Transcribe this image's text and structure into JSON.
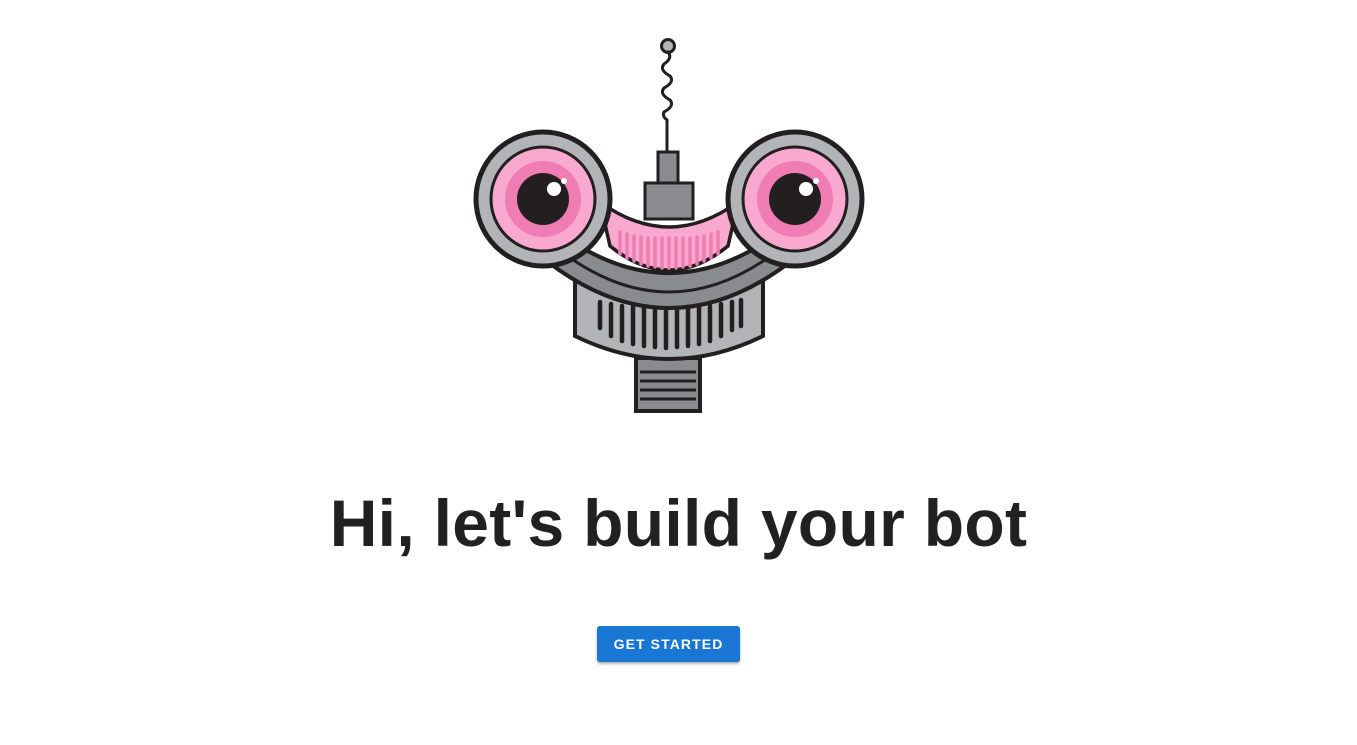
{
  "hero": {
    "illustration_icon": "robot-head-icon",
    "headline": "Hi, let's build your bot"
  },
  "cta": {
    "label": "GET STARTED",
    "color": "#1976d2"
  },
  "colors": {
    "background": "#ffffff",
    "text": "#212121",
    "robot_pink": "#f07cb4",
    "robot_light_pink": "#f9a8cf",
    "robot_gray": "#8a8b8e",
    "robot_light_gray": "#b3b4b7",
    "robot_outline": "#231f20"
  }
}
